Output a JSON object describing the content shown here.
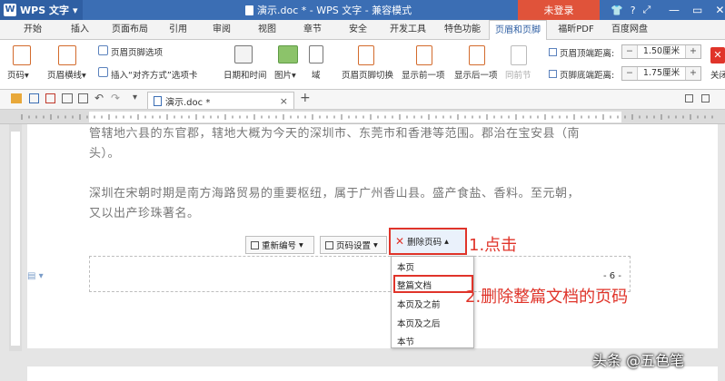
{
  "titlebar": {
    "app_name": "WPS 文字",
    "app_logo": "W",
    "document_title": "演示.doc * - WPS 文字 - 兼容模式",
    "login_label": "未登录",
    "minimize": "—",
    "restore": "▭",
    "close": "✕",
    "help": "?"
  },
  "menu_tabs": [
    "开始",
    "插入",
    "页面布局",
    "引用",
    "审阅",
    "视图",
    "章节",
    "安全",
    "开发工具",
    "特色功能",
    "页眉和页脚",
    "福昕PDF",
    "百度网盘"
  ],
  "active_tab": "页眉和页脚",
  "ribbon": {
    "header_footer_options": "页眉页脚选项",
    "page_number": "页码",
    "header_line": "页眉横线",
    "insert_align_tab": "插入“对齐方式”选项卡",
    "date_time": "日期和时间",
    "picture": "图片",
    "field": "域",
    "switch_header_footer": "页眉页脚切换",
    "show_previous": "显示前一项",
    "show_next": "显示后一项",
    "same_as_previous": "同前节",
    "header_top_distance_label": "页眉顶端距离:",
    "header_top_distance_value": "1.50厘米",
    "footer_bottom_distance_label": "页脚底端距离:",
    "footer_bottom_distance_value": "1.75厘米",
    "close_label": "关闭"
  },
  "doc_tab": {
    "name": "演示.doc *",
    "close": "×",
    "new_tab": "+"
  },
  "document": {
    "para1_line1": "管辖地六县的东官郡，辖地大概为今天的深圳市、东莞市和香港等范围。郡治在宝安县（南",
    "para1_line2": "头）。",
    "para2_line1": "深圳在宋朝时期是南方海路贸易的重要枢纽，属于广州香山县。盛产食盐、香料。至元朝，",
    "para2_line2": "又以出产珍珠著名。",
    "page_number": "- 6 -"
  },
  "footer_toolbar": {
    "renumber": "重新编号",
    "page_number_settings": "页码设置",
    "delete_page_number": "删除页码"
  },
  "dropdown": {
    "items": [
      "本页",
      "整篇文档",
      "本页及之前",
      "本页及之后",
      "本节"
    ]
  },
  "annotations": {
    "step1": "1.点击",
    "step2": "2.删除整篇文档的页码"
  },
  "watermark": "头条 @五色笔",
  "colors": {
    "title_blue": "#3b6eb4",
    "login_red": "#e0533a",
    "highlight_red": "#e0342a"
  }
}
